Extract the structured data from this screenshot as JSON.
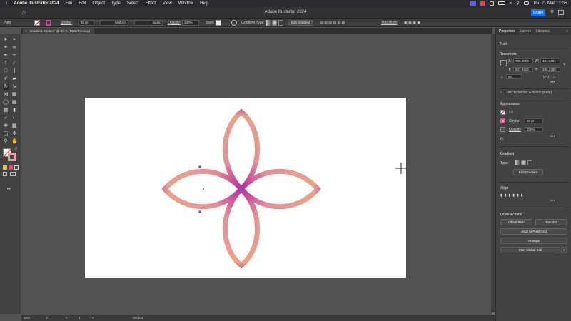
{
  "menubar": {
    "app_name": "Adobe Illustrator 2024",
    "items": [
      "File",
      "Edit",
      "Object",
      "Type",
      "Select",
      "Effect",
      "View",
      "Window",
      "Help"
    ],
    "datetime": "Thu 21 Mar 13:06"
  },
  "app_header": {
    "title": "Adobe Illustrator 2024",
    "share_label": "Share"
  },
  "control_bar": {
    "selection_type": "Path",
    "stroke_label": "Stroke:",
    "stroke_value": "30 pt",
    "profile_label": "Uniform",
    "brush_label": "Basic",
    "opacity_label": "Opacity:",
    "opacity_value": "100%",
    "style_label": "Style:",
    "gradient_type_label": "Gradient Type:",
    "edit_gradient_label": "Edit Gradient",
    "transform_label": "Transform"
  },
  "document_tab": {
    "title": "Gradient Strokes* @ 50 % (RGB/Preview)",
    "close": "×"
  },
  "status_bar": {
    "zoom": "50%",
    "rotation": "0°",
    "artboard_number": "1",
    "tool_name": "Anchor"
  },
  "properties_panel": {
    "tabs": [
      "Properties",
      "Layers",
      "Libraries"
    ],
    "selection_type": "Path",
    "transform": {
      "title": "Transform",
      "x_label": "X:",
      "x_value": "709.4693",
      "w_label": "W:",
      "w_value": "451.0481",
      "y_label": "Y:",
      "y_value": "547.8215",
      "h_label": "H:",
      "h_value": "286.2358",
      "angle_value": "90°"
    },
    "text_to_vector": "Text to Vector Graphic (Beta)",
    "appearance": {
      "title": "Appearance",
      "fill_label": "Fill",
      "stroke_label": "Stroke",
      "stroke_value": "30 pt",
      "opacity_label": "Opacity",
      "opacity_value": "100%",
      "fx_label": "fx."
    },
    "gradient": {
      "title": "Gradient",
      "type_label": "Type:",
      "edit_button": "Edit Gradient"
    },
    "align": {
      "title": "Align"
    },
    "quick_actions": {
      "title": "Quick Actions",
      "offset_path": "Offset Path",
      "recolor": "Recolor",
      "align_to_pixel_grid": "Align to Pixel Grid",
      "arrange": "Arrange",
      "start_global_edit": "Start Global Edit"
    },
    "more": "•••"
  },
  "colors": {
    "gradient_start": "#b72c9e",
    "gradient_mid": "#e48f98",
    "gradient_peach": "#e8a48a",
    "accent_blue": "#1473e6"
  }
}
